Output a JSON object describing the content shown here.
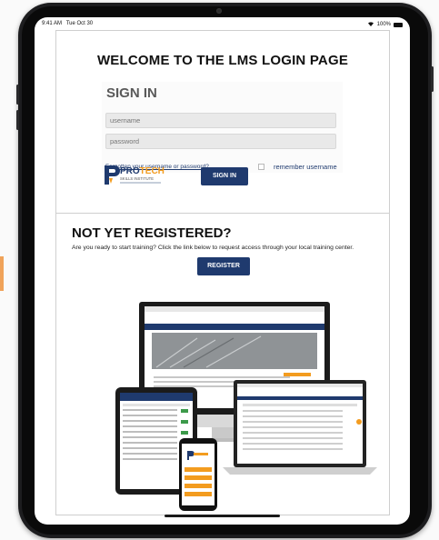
{
  "status": {
    "time": "9:41 AM",
    "date": "Tue Oct 30",
    "battery": "100%"
  },
  "page": {
    "welcome_title": "WELCOME TO THE LMS LOGIN PAGE",
    "signin": {
      "title": "SIGN IN",
      "username_placeholder": "username",
      "password_placeholder": "password",
      "forgot_link": "Forgotten your username or password?",
      "remember_label": "remember username",
      "button_label": "SIGN IN"
    },
    "logo": {
      "brand": "PROTECH",
      "tagline": "SKILLS INSTITUTE"
    },
    "register": {
      "heading": "NOT YET REGISTERED?",
      "text": "Are you ready to start training? Click the link below to request access through your local training center.",
      "button_label": "REGISTER"
    },
    "colors": {
      "brand_navy": "#1f3a6e",
      "brand_orange": "#f39c1f"
    }
  }
}
